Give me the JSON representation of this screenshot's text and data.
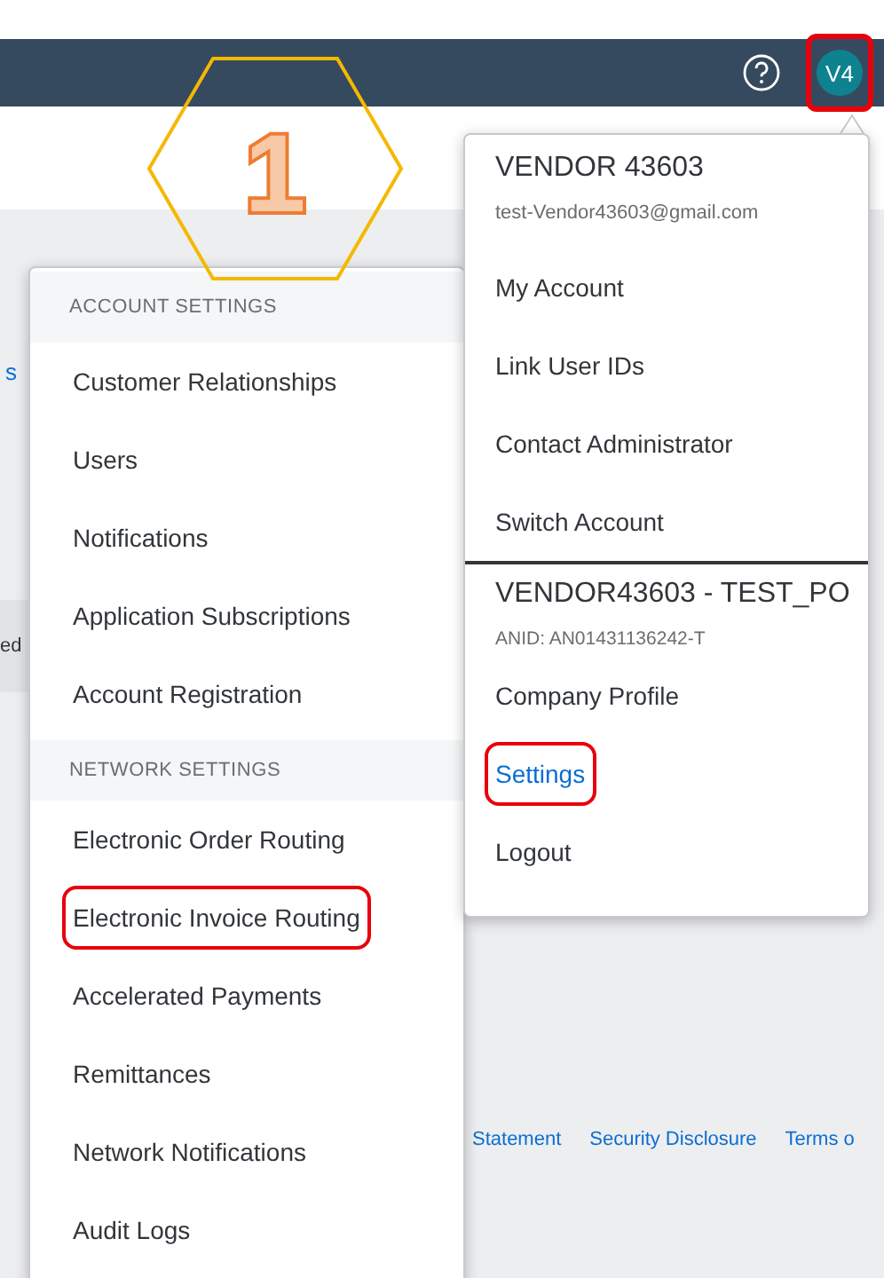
{
  "header": {
    "avatar": {
      "initials": "V4",
      "highlighted": true
    }
  },
  "annotation": {
    "number": "1"
  },
  "background_fragments": [
    {
      "kind": "link",
      "text": "s"
    },
    {
      "kind": "text",
      "text": "ed"
    }
  ],
  "footer_links": [
    "Statement",
    "Security Disclosure",
    "Terms o"
  ],
  "settings_menu": {
    "sections": [
      {
        "heading": "ACCOUNT SETTINGS",
        "items": [
          {
            "label": "Customer Relationships",
            "highlighted": false
          },
          {
            "label": "Users",
            "highlighted": false
          },
          {
            "label": "Notifications",
            "highlighted": false
          },
          {
            "label": "Application Subscriptions",
            "highlighted": false
          },
          {
            "label": "Account Registration",
            "highlighted": false
          }
        ]
      },
      {
        "heading": "NETWORK SETTINGS",
        "items": [
          {
            "label": "Electronic Order Routing",
            "highlighted": false
          },
          {
            "label": "Electronic Invoice Routing",
            "highlighted": true
          },
          {
            "label": "Accelerated Payments",
            "highlighted": false
          },
          {
            "label": "Remittances",
            "highlighted": false
          },
          {
            "label": "Network Notifications",
            "highlighted": false
          },
          {
            "label": "Audit Logs",
            "highlighted": false
          }
        ]
      }
    ]
  },
  "account_menu": {
    "name": "VENDOR 43603",
    "email": "test-Vendor43603@gmail.com",
    "items": [
      {
        "label": "My Account",
        "selected": false,
        "highlighted": false
      },
      {
        "label": "Link User IDs",
        "selected": false,
        "highlighted": false
      },
      {
        "label": "Contact Administrator",
        "selected": false,
        "highlighted": false
      },
      {
        "label": "Switch Account",
        "selected": false,
        "highlighted": false
      }
    ],
    "company": {
      "name": "VENDOR43603 - TEST_PO",
      "anid": "ANID: AN01431136242-T"
    },
    "company_items": [
      {
        "label": "Company Profile",
        "selected": false,
        "highlighted": false
      },
      {
        "label": "Settings",
        "selected": true,
        "highlighted": true
      },
      {
        "label": "Logout",
        "selected": false,
        "highlighted": false
      }
    ]
  }
}
